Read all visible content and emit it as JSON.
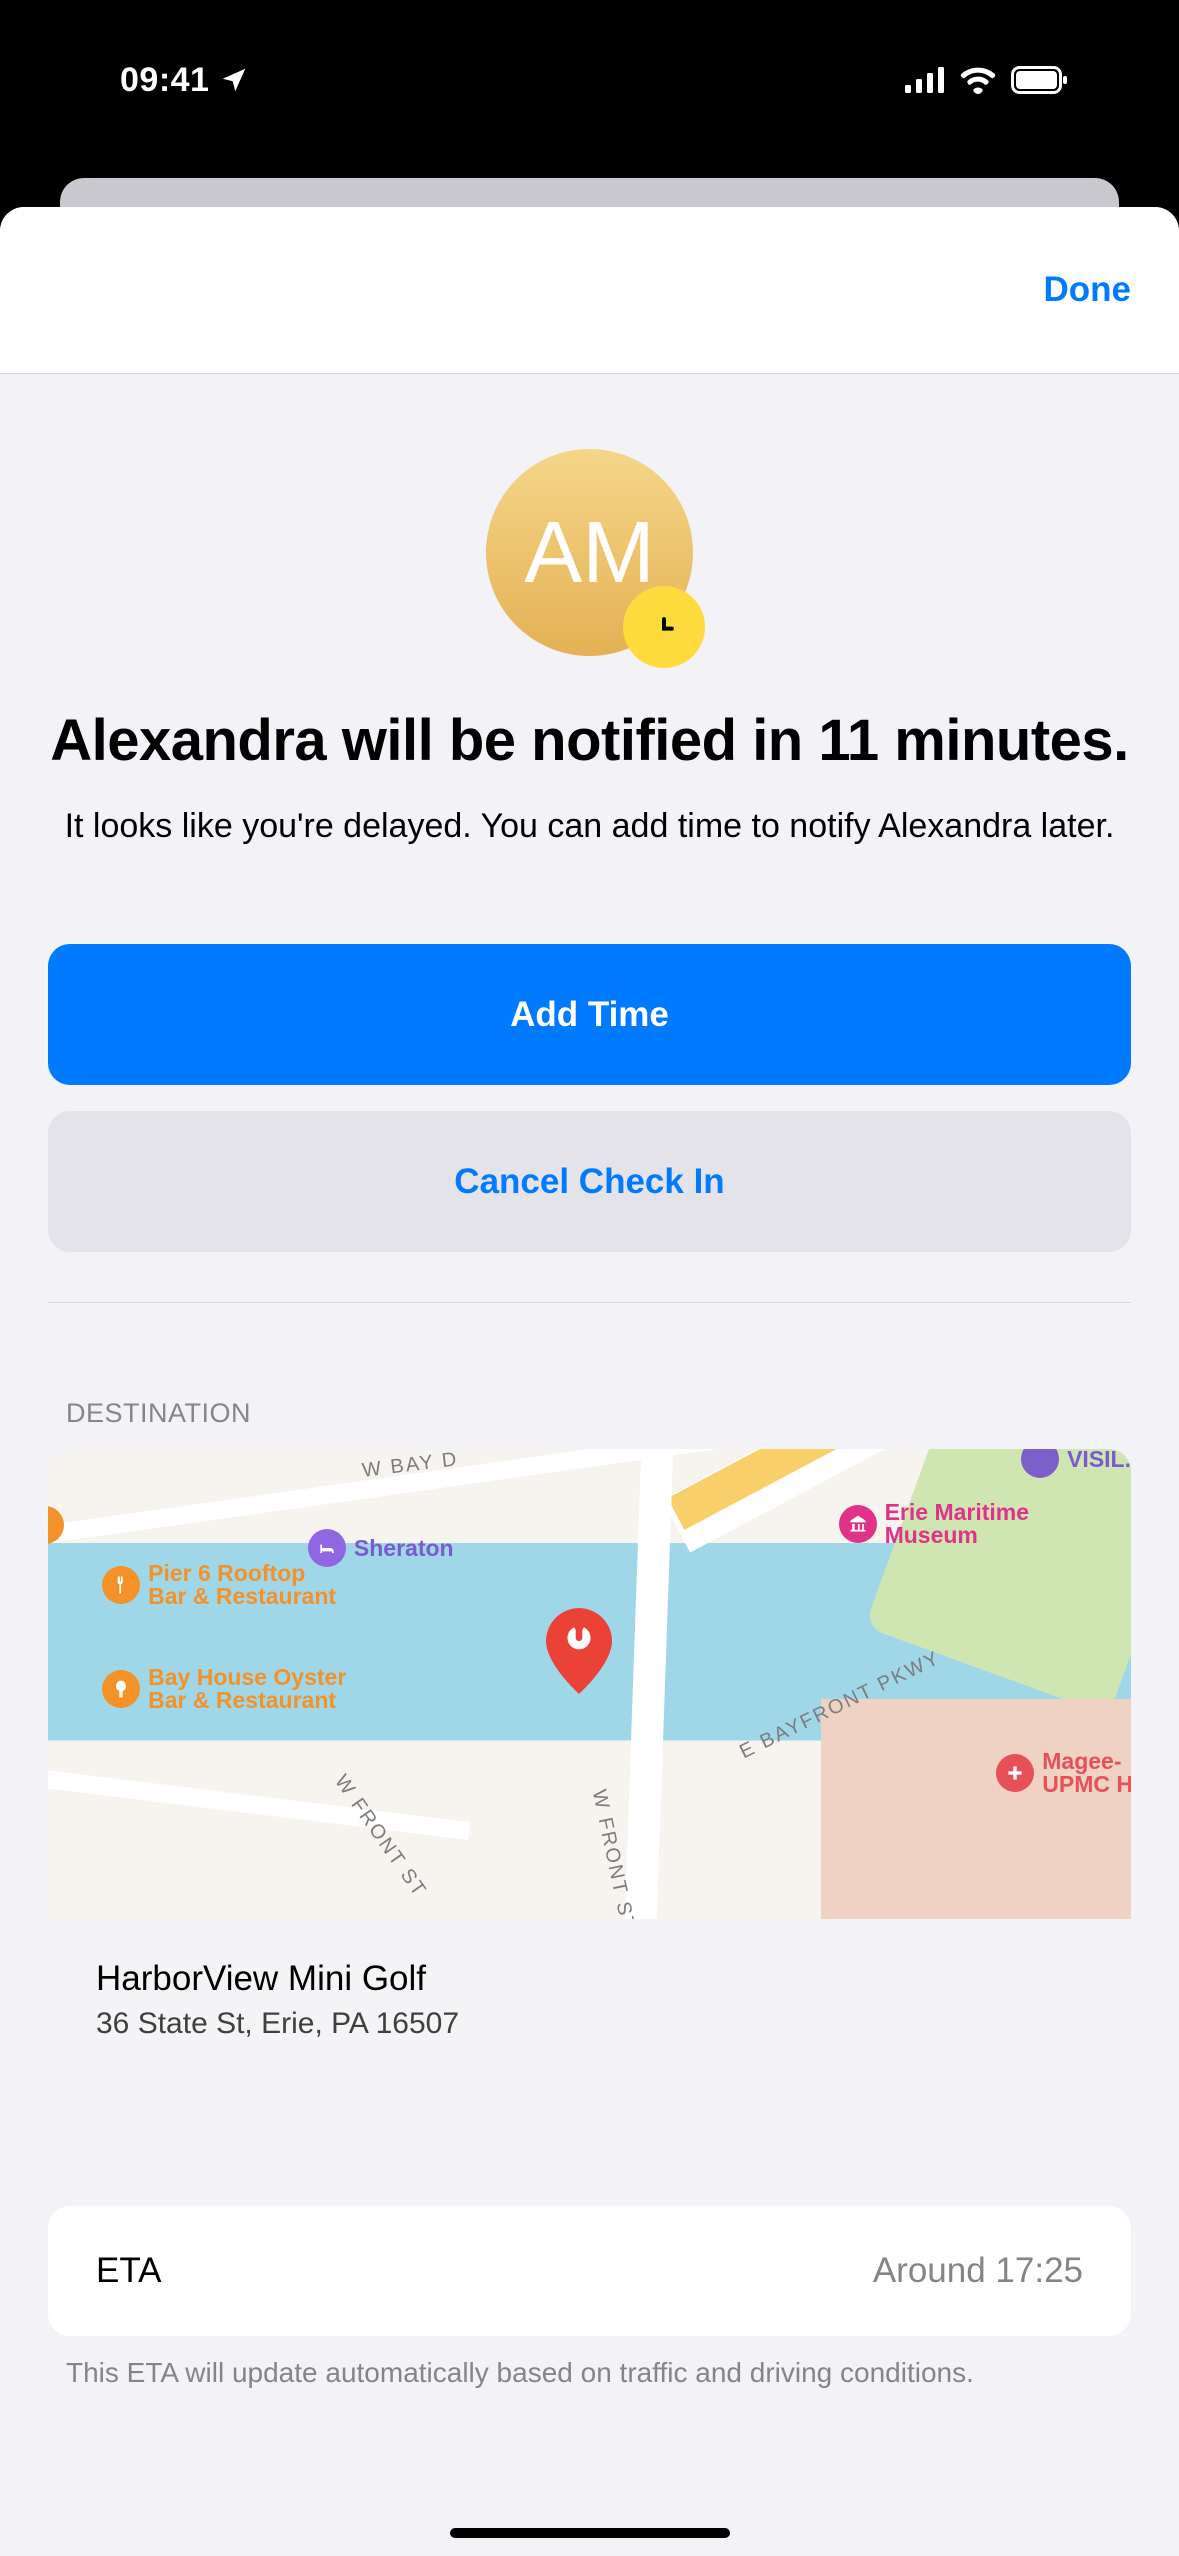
{
  "status": {
    "time": "09:41"
  },
  "nav": {
    "done_label": "Done"
  },
  "avatar": {
    "initials": "AM"
  },
  "headline": "Alexandra will be notified in 11 minutes.",
  "subtext": "It looks like you're delayed. You can add time to notify Alexandra later.",
  "buttons": {
    "add_time": "Add Time",
    "cancel": "Cancel Check In"
  },
  "destination": {
    "section_label": "DESTINATION",
    "name": "HarborView Mini Golf",
    "address": "36 State St, Erie, PA  16507",
    "map_pois": {
      "sheraton": "Sheraton",
      "pier6_l1": "Pier 6 Rooftop",
      "pier6_l2": "Bar & Restaurant",
      "bayhouse_l1": "Bay House Oyster",
      "bayhouse_l2": "Bar & Restaurant",
      "museum_l1": "Erie Maritime",
      "museum_l2": "Museum",
      "magee_l1": "Magee-",
      "magee_l2": "UPMC H",
      "visit": "VISIL.",
      "road_bay": "W BAY D",
      "road_front1": "W FRONT ST",
      "road_front2": "W FRONT ST",
      "road_bayfront": "E BAYFRONT PKWY"
    }
  },
  "eta": {
    "label": "ETA",
    "value": "Around 17:25",
    "note": "This ETA will update automatically based on traffic and driving conditions."
  }
}
